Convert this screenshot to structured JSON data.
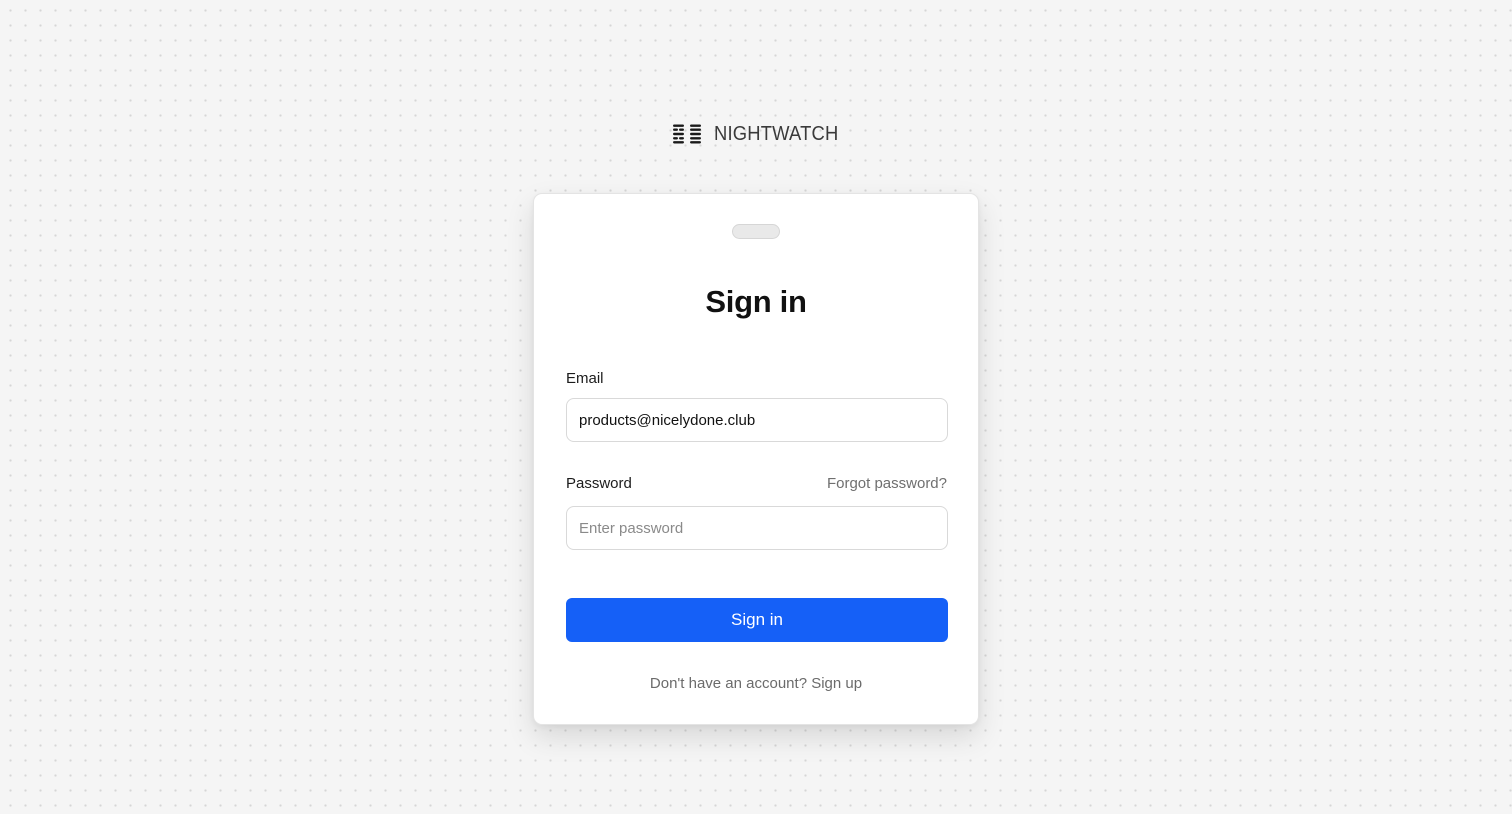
{
  "brand": {
    "name": "NIGHTWATCH",
    "logo_icon": "nightwatch-logo-icon"
  },
  "form": {
    "title": "Sign in",
    "email": {
      "label": "Email",
      "value": "products@nicelydone.club",
      "placeholder": ""
    },
    "password": {
      "label": "Password",
      "value": "",
      "placeholder": "Enter password",
      "forgot_label": "Forgot password?"
    },
    "submit_label": "Sign in",
    "signup_prompt": "Don't have an account?",
    "signup_label": "Sign up"
  },
  "colors": {
    "accent": "#1560f7",
    "background": "#f5f5f5",
    "card": "#ffffff"
  }
}
